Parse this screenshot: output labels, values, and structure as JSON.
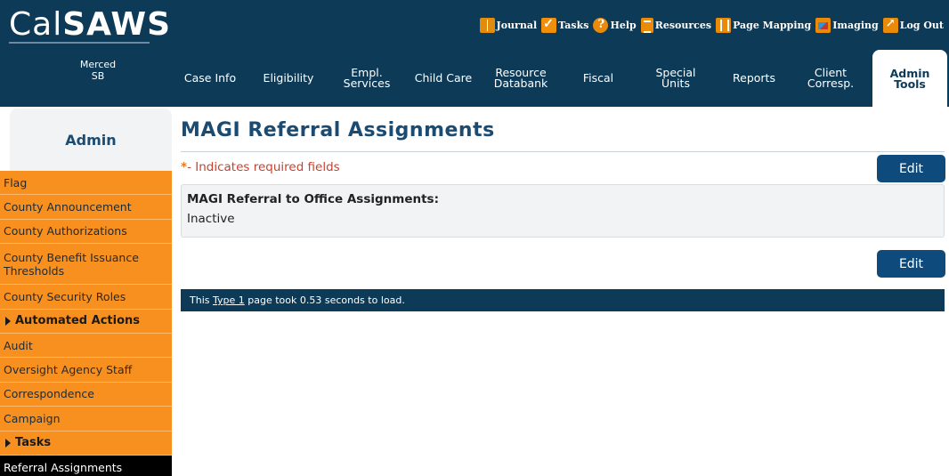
{
  "header": {
    "logo_thin": "Cal",
    "logo_bold": "SAWS",
    "links": [
      {
        "label": "Journal",
        "icon": "journal-icon"
      },
      {
        "label": "Tasks",
        "icon": "tasks-icon"
      },
      {
        "label": "Help",
        "icon": "help-icon"
      },
      {
        "label": "Resources",
        "icon": "resources-icon"
      },
      {
        "label": "Page Mapping",
        "icon": "page-mapping-icon"
      },
      {
        "label": "Imaging",
        "icon": "imaging-icon"
      },
      {
        "label": "Log Out",
        "icon": "log-out-icon"
      }
    ]
  },
  "nav": {
    "user_line1": "Merced",
    "user_line2": "SB",
    "tabs": [
      {
        "line1": "Case Info",
        "line2": ""
      },
      {
        "line1": "Eligibility",
        "line2": ""
      },
      {
        "line1": "Empl.",
        "line2": "Services"
      },
      {
        "line1": "Child Care",
        "line2": ""
      },
      {
        "line1": "Resource",
        "line2": "Databank"
      },
      {
        "line1": "Fiscal",
        "line2": ""
      },
      {
        "line1": "Special",
        "line2": "Units"
      },
      {
        "line1": "Reports",
        "line2": ""
      },
      {
        "line1": "Client",
        "line2": "Corresp."
      },
      {
        "line1": "Admin",
        "line2": "Tools"
      }
    ]
  },
  "sidebar": {
    "heading": "Admin",
    "items": [
      {
        "label": "Flag"
      },
      {
        "label": "County Announcement"
      },
      {
        "label": "County Authorizations"
      },
      {
        "label": "County Benefit Issuance Thresholds"
      },
      {
        "label": "County Security Roles"
      },
      {
        "label": "Automated Actions"
      },
      {
        "label": "Audit"
      },
      {
        "label": "Oversight Agency Staff"
      },
      {
        "label": "Correspondence"
      },
      {
        "label": "Campaign"
      },
      {
        "label": "Tasks"
      },
      {
        "label": "Referral Assignments"
      }
    ]
  },
  "main": {
    "title": "MAGI Referral Assignments",
    "required_star": "*",
    "required_text": "- Indicates required fields",
    "edit_label_top": "Edit",
    "edit_label_bottom": "Edit",
    "panel": {
      "label": "MAGI Referral to Office Assignments:",
      "value": "Inactive"
    },
    "footer": {
      "prefix": "This ",
      "link": "Type 1",
      "suffix": " page took 0.53 seconds to load."
    }
  },
  "colors": {
    "header_bg": "#0d3a57",
    "sidebar_item_bg": "#f7901e",
    "title_color": "#1c4b72",
    "button_bg": "#0f4a7c",
    "required_color": "#c8422f"
  }
}
